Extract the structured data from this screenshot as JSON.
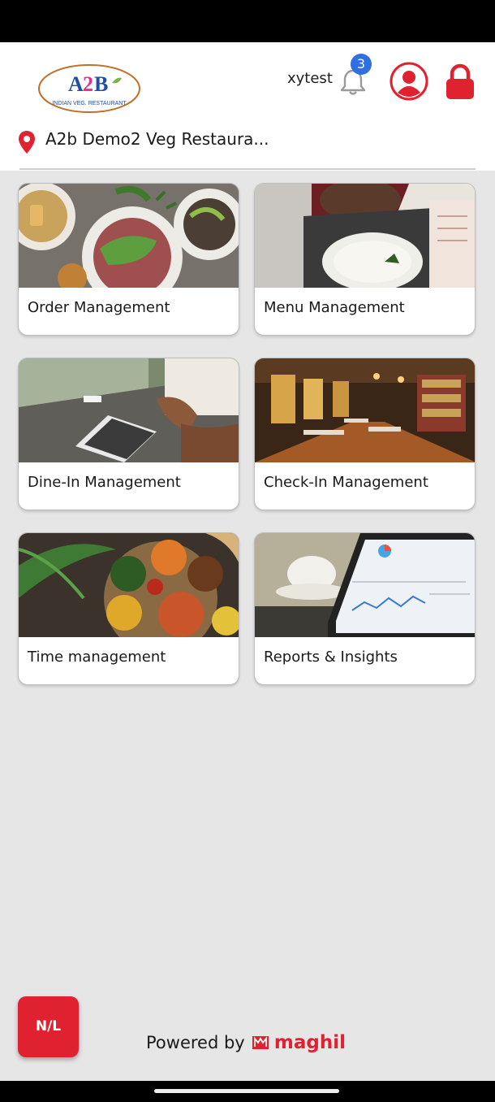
{
  "header": {
    "logo": {
      "brand": "A2B",
      "tagline": "INDIAN VEG. RESTAURANT"
    },
    "username": "xytest",
    "notification_count": "3",
    "icons": [
      "bell-icon",
      "user-profile-icon",
      "lock-icon"
    ]
  },
  "location": {
    "icon": "map-pin-icon",
    "name": "A2b Demo2 Veg Restaura..."
  },
  "tiles": [
    {
      "label": "Order Management",
      "image": "food-platter-photo"
    },
    {
      "label": "Menu Management",
      "image": "menu-card-photo"
    },
    {
      "label": "Dine-In Management",
      "image": "tablet-table-photo"
    },
    {
      "label": "Check-In Management",
      "image": "restaurant-interior-photo"
    },
    {
      "label": "Time management",
      "image": "indian-thali-photo"
    },
    {
      "label": "Reports & Insights",
      "image": "analytics-tablet-photo"
    }
  ],
  "floating_button": {
    "label": "N/L"
  },
  "footer": {
    "powered_by": "Powered by",
    "brand": "maghil"
  },
  "colors": {
    "accent": "#e0212f",
    "badge": "#2f6fe0",
    "background": "#e6e6e6"
  }
}
